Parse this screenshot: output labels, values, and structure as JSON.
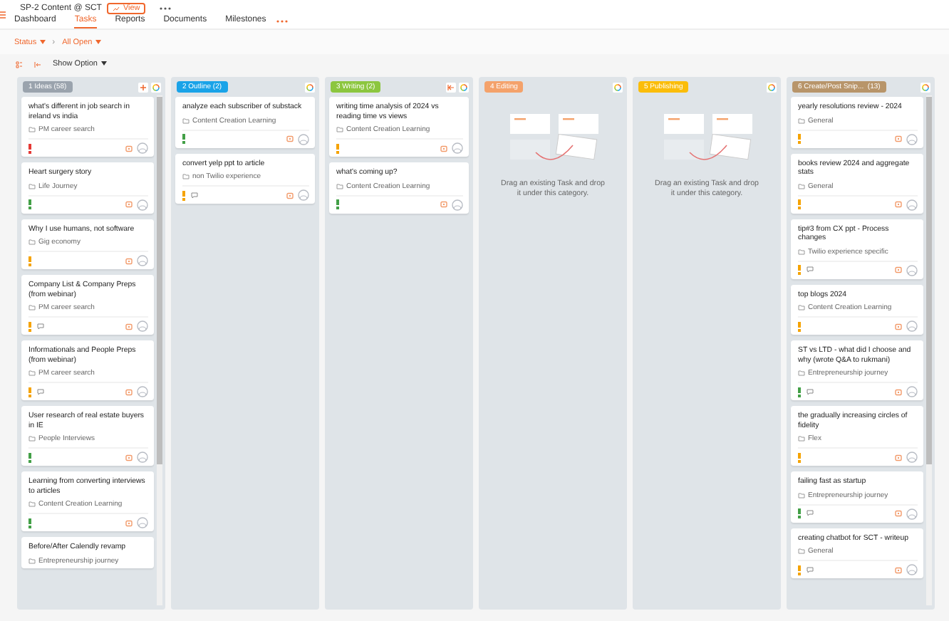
{
  "project": {
    "title": "SP-2 Content @ SCT",
    "view_button": "View"
  },
  "tabs": [
    {
      "label": "Dashboard",
      "selected": false
    },
    {
      "label": "Tasks",
      "selected": true
    },
    {
      "label": "Reports",
      "selected": false
    },
    {
      "label": "Documents",
      "selected": false
    },
    {
      "label": "Milestones",
      "selected": false
    }
  ],
  "filters": {
    "status": "Status",
    "separator": "›",
    "view": "All Open"
  },
  "toolbar": {
    "show_option": "Show Option"
  },
  "columns": [
    {
      "label": "1 Ideas (58)",
      "color": "#9aa3ad",
      "add_button": true,
      "collapse_button": false,
      "scrollbar": true,
      "cards": [
        {
          "title": "what's different in job search in ireland vs india",
          "tag": "PM career search",
          "color": "#e53935",
          "comments": false
        },
        {
          "title": "Heart surgery story",
          "tag": "Life Journey",
          "color": "#43a047",
          "comments": false
        },
        {
          "title": "Why I use humans, not software",
          "tag": "Gig economy",
          "color": "#f5a300",
          "comments": false
        },
        {
          "title": "Company List & Company Preps (from webinar)",
          "tag": "PM career search",
          "color": "#f5a300",
          "comments": true
        },
        {
          "title": "Informationals and People Preps (from webinar)",
          "tag": "PM career search",
          "color": "#f5a300",
          "comments": true
        },
        {
          "title": "User research of real estate buyers in IE",
          "tag": "People Interviews",
          "color": "#43a047",
          "comments": false
        },
        {
          "title": "Learning from converting interviews to articles",
          "tag": "Content Creation Learning",
          "color": "#43a047",
          "comments": false
        },
        {
          "title": "Before/After Calendly revamp",
          "tag": "Entrepreneurship journey"
        }
      ]
    },
    {
      "label": "2 Outline (2)",
      "color": "#1aa3e8",
      "add_button": false,
      "collapse_button": false,
      "scrollbar": false,
      "cards": [
        {
          "title": "analyze each subscriber of substack",
          "tag": "Content Creation Learning",
          "color": "#43a047",
          "comments": false
        },
        {
          "title": "convert yelp ppt to article",
          "tag": "non Twilio experience",
          "color": "#f5a300",
          "comments": true
        }
      ]
    },
    {
      "label": "3 Writing (2)",
      "color": "#8cc63f",
      "add_button": false,
      "collapse_button": true,
      "scrollbar": false,
      "cards": [
        {
          "title": "writing time analysis of 2024 vs reading time vs views",
          "tag": "Content Creation Learning",
          "color": "#f5a300",
          "comments": false
        },
        {
          "title": "what's coming up?",
          "tag": "Content Creation Learning",
          "color": "#43a047",
          "comments": false
        }
      ]
    },
    {
      "label": "4 Editing",
      "color": "#f4a26b",
      "add_button": false,
      "collapse_button": false,
      "scrollbar": false,
      "empty_text": "Drag an existing Task and drop it under this category."
    },
    {
      "label": "5 Publishing",
      "color": "#fbbd0a",
      "add_button": false,
      "collapse_button": false,
      "scrollbar": false,
      "empty_text": "Drag an existing Task and drop it under this category."
    },
    {
      "label": "6 Create/Post Snip...  (13)",
      "color": "#b8956a",
      "add_button": false,
      "collapse_button": false,
      "scrollbar": true,
      "cards": [
        {
          "title": "yearly resolutions review - 2024",
          "tag": "General",
          "color": "#f5a300",
          "comments": false
        },
        {
          "title": "books review 2024 and aggregate stats",
          "tag": "General",
          "color": "#f5a300",
          "comments": false
        },
        {
          "title": "tip#3 from CX ppt - Process changes",
          "tag": "Twilio experience specific",
          "color": "#f5a300",
          "comments": true
        },
        {
          "title": "top blogs 2024",
          "tag": "Content Creation Learning",
          "color": "#f5a300",
          "comments": false
        },
        {
          "title": "ST vs LTD - what did I choose and why (wrote Q&A to rukmani)",
          "tag": "Entrepreneurship journey",
          "color": "#43a047",
          "comments": true
        },
        {
          "title": "the gradually increasing circles of fidelity",
          "tag": "Flex",
          "color": "#f5a300",
          "comments": false
        },
        {
          "title": "failing fast as startup",
          "tag": "Entrepreneurship journey",
          "color": "#43a047",
          "comments": true
        },
        {
          "title": "creating chatbot for SCT - writeup",
          "tag": "General",
          "color": "#f5a300",
          "comments": true
        }
      ]
    }
  ]
}
